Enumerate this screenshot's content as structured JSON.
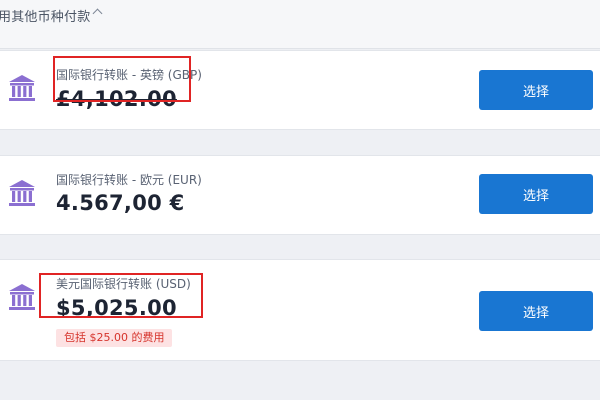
{
  "section": {
    "title": "用其他币种付款"
  },
  "options": [
    {
      "label": "国际银行转账 - 英镑 (GBP)",
      "amount": "£4,102.00",
      "button": "选择"
    },
    {
      "label": "国际银行转账 - 欧元 (EUR)",
      "amount": "4.567,00 €",
      "button": "选择"
    },
    {
      "label": "美元国际银行转账 (USD)",
      "amount": "$5,025.00",
      "button": "选择",
      "fee_note": "包括 $25.00 的费用"
    }
  ],
  "colors": {
    "accent": "#1976d2",
    "icon": "#8b6fd1",
    "fee_text": "#d6342c",
    "fee_bg": "#fde2e3",
    "highlight": "#e02424"
  },
  "icons": {
    "bank": "bank-icon",
    "collapse": "chevron-up-icon"
  }
}
